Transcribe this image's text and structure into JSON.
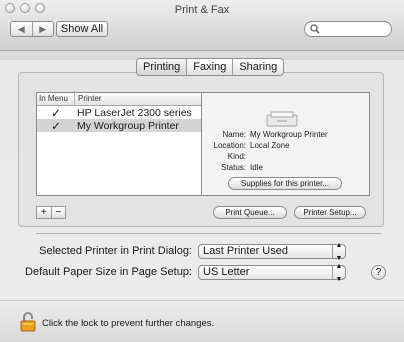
{
  "window": {
    "title": "Print & Fax"
  },
  "toolbar": {
    "back_icon": "back-arrow-icon",
    "forward_icon": "forward-arrow-icon",
    "show_all_label": "Show All",
    "search_placeholder": ""
  },
  "tabs": [
    {
      "label": "Printing",
      "selected": true
    },
    {
      "label": "Faxing",
      "selected": false
    },
    {
      "label": "Sharing",
      "selected": false
    }
  ],
  "printer_list": {
    "headers": {
      "in_menu": "In Menu",
      "printer": "Printer"
    },
    "rows": [
      {
        "checked": true,
        "name": "HP LaserJet 2300 series",
        "selected": false
      },
      {
        "checked": true,
        "name": "My Workgroup Printer",
        "selected": true
      }
    ]
  },
  "printer_detail": {
    "fields": [
      {
        "key": "Name:",
        "value": "My Workgroup Printer"
      },
      {
        "key": "Location:",
        "value": "Local Zone"
      },
      {
        "key": "Kind:",
        "value": ""
      },
      {
        "key": "Status:",
        "value": "Idle"
      }
    ],
    "supplies_label": "Supplies for this printer..."
  },
  "list_controls": {
    "add_label": "+",
    "remove_label": "−"
  },
  "buttons": {
    "print_queue": "Print Queue...",
    "printer_setup": "Printer Setup..."
  },
  "selected_printer": {
    "label": "Selected Printer in Print Dialog:",
    "value": "Last Printer Used"
  },
  "paper_size": {
    "label": "Default Paper Size in Page Setup:",
    "value": "US Letter"
  },
  "help_label": "?",
  "footer": {
    "lock_text": "Click the lock to prevent further changes."
  }
}
